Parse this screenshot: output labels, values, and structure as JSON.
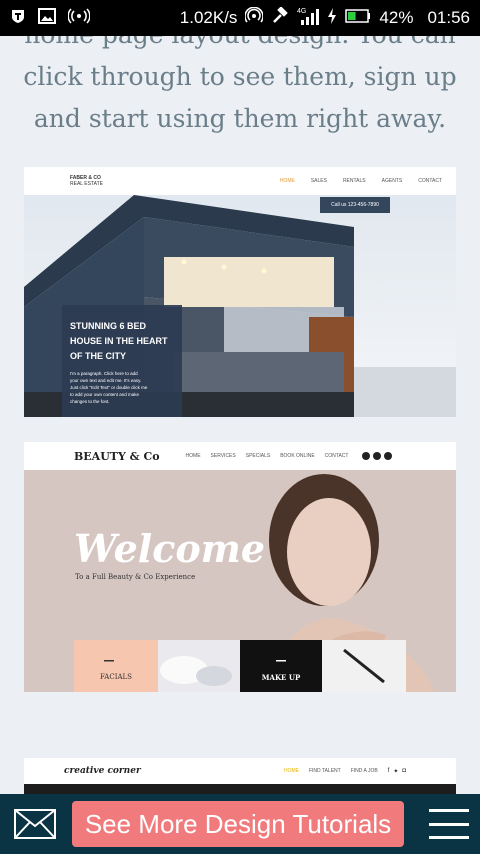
{
  "status_bar": {
    "network_speed": "1.02K/s",
    "battery_percent": "42%",
    "time": "01:56",
    "battery_level": 0.42
  },
  "article": {
    "intro_lines": [
      "home page layout design. You can",
      "click through to see them, sign up",
      "and start using them right away."
    ]
  },
  "templates": [
    {
      "brand": "FABER & CO",
      "brand_sub": "REAL ESTATE",
      "nav": [
        "HOME",
        "SALES",
        "RENTALS",
        "AGENTS",
        "CONTACT"
      ],
      "phone": "Call us 123-456-7890",
      "headline_lines": [
        "STUNNING 6 BED",
        "HOUSE IN THE HEART",
        "OF THE CITY"
      ],
      "body_lines": [
        "I'm a paragraph. Click here to add",
        "your own text and edit me. It's easy.",
        "Just click \"Edit Text\" or double click me",
        "to add your own content and make",
        "changes to the font."
      ]
    },
    {
      "brand": "BEAUTY & Co",
      "nav": [
        "HOME",
        "SERVICES",
        "SPECIALS",
        "BOOK ONLINE",
        "CONTACT"
      ],
      "welcome": "Welcome",
      "tagline": "To a Full Beauty & Co Experience",
      "tile_labels": [
        "FACIALS",
        "MAKE UP"
      ]
    },
    {
      "brand": "creative corner",
      "nav": [
        "HOME",
        "FIND TALENT",
        "FIND A JOB"
      ]
    }
  ],
  "bottom_bar": {
    "cta_label": "See More Design Tutorials"
  }
}
